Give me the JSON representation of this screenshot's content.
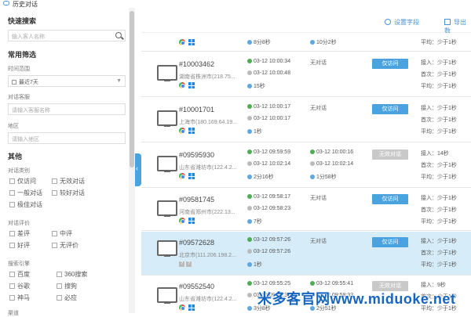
{
  "window": {
    "title": "历史对话"
  },
  "sidebar": {
    "quick_search_title": "快速搜索",
    "quick_search_placeholder": "输入客人名称",
    "common_filter_title": "常用筛选",
    "time_range_label": "时间范围",
    "time_range_value": "最近7天",
    "service_label": "对话客服",
    "service_placeholder": "请输入客服名称",
    "region_label": "地区",
    "region_placeholder": "请输入地区",
    "other_title": "其他",
    "dialog_type_label": "对话类别",
    "dialog_types": [
      "仅访问",
      "无效对话",
      "一般对话",
      "较好对话",
      "极佳对话"
    ],
    "rating_label": "对话评价",
    "ratings": [
      "差评",
      "中评",
      "好评",
      "无评价"
    ],
    "engine_label": "搜索引擎",
    "engines": [
      "百度",
      "360搜索",
      "谷歌",
      "搜狗",
      "神马",
      "必应"
    ],
    "next_label": "渠道"
  },
  "toolbar": {
    "settings_label": "设置字段",
    "export_label": "导出数"
  },
  "rows": [
    {
      "id": "",
      "location": "",
      "start": "",
      "end": "",
      "duration": "8分8秒",
      "reply_time": "",
      "reply_duration": "10分2秒",
      "dialog": "",
      "button": "",
      "stats": [
        "",
        "",
        "平均：少于1秒"
      ]
    },
    {
      "id": "#10003462",
      "location": "湖南省株洲市(218.75...",
      "start": "03-12 10:00:34",
      "end": "03-12 10:00:48",
      "duration": "15秒",
      "dialog": "无对话",
      "button": "仅访问",
      "stats": [
        "接入：少于1秒",
        "首次：少于1秒",
        "平均：少于1秒"
      ]
    },
    {
      "id": "#10001701",
      "location": "上海市(180.169.64.19...",
      "start": "03-12 10:00:17",
      "end": "03-12 10:00:17",
      "duration": "1秒",
      "dialog": "无对话",
      "button": "仅访问",
      "stats": [
        "接入：少于1秒",
        "首次：少于1秒",
        "平均：少于1秒"
      ]
    },
    {
      "id": "#09595930",
      "location": "山东省潍坊市(122.4.2...",
      "start": "03-12 09:59:59",
      "end": "03-12 10:02:14",
      "duration": "2分16秒",
      "reply_time": "03-12 10:00:16",
      "reply_end": "03-12 10:02:14",
      "reply_duration": "1分58秒",
      "button": "无效对话",
      "stats": [
        "接入：14秒",
        "首次：少于1秒",
        "平均：少于1秒"
      ]
    },
    {
      "id": "#09581745",
      "location": "河南省郑州市(222.13...",
      "start": "03-12 09:58:17",
      "end": "03-12 09:58:23",
      "duration": "7秒",
      "dialog": "无对话",
      "button": "仅访问",
      "stats": [
        "接入：少于1秒",
        "首次：少于1秒",
        "平均：少于1秒"
      ]
    },
    {
      "id": "#09572628",
      "location": "北京市(111.206.198.2...",
      "start": "03-12 09:57:26",
      "end": "03-12 09:57:26",
      "duration": "1秒",
      "dialog": "无对话",
      "button": "仅访问",
      "stats": [
        "接入：少于1秒",
        "首次：少于1秒",
        "平均：少于1秒"
      ]
    },
    {
      "id": "#09552540",
      "location": "山东省潍坊市(122.4.2...",
      "start": "03-12 09:55:25",
      "end": "03-12 09:58:33",
      "duration": "3分8秒",
      "reply_time": "03-12 09:55:41",
      "reply_end": "03-12 09:58:33",
      "reply_duration": "2分51秒",
      "button": "无效对话",
      "stats": [
        "接入：9秒",
        "首次：少于1秒",
        "平均：少于1秒"
      ]
    }
  ],
  "watermark": "米多客官网www.miduoke.net",
  "colors": {
    "accent": "#4aa3df",
    "highlight_row": "#d6ecf8",
    "invalid_button": "#c9c9c9"
  }
}
